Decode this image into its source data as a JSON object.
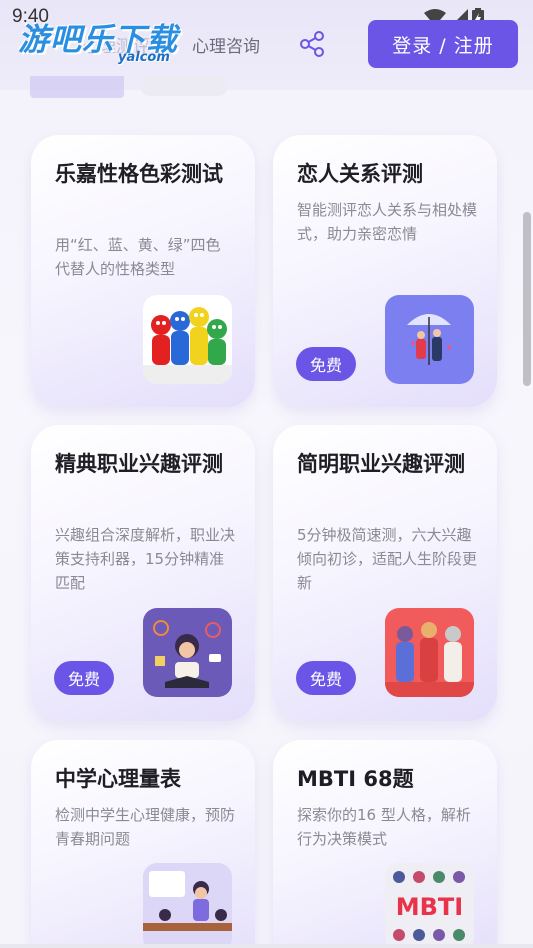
{
  "status_bar": {
    "time": "9:40"
  },
  "watermark": {
    "main": "游吧乐下载",
    "sub": "yalcom"
  },
  "header": {
    "tab_psych_test": "心理测评",
    "tab_psych_consult": "心理咨询",
    "login_label": "登录 / 注册"
  },
  "colors": {
    "accent": "#6a55e6",
    "card_end": "#e4defb"
  },
  "cards": [
    {
      "title": "乐嘉性格色彩测试",
      "desc": "用“红、蓝、黄、绿”四色代替人的性格类型",
      "badge": "",
      "icon": "four-color-people-icon"
    },
    {
      "title": "恋人关系评测",
      "desc": "智能测评恋人关系与相处模式，助力亲密恋情",
      "badge": "免费",
      "icon": "couple-umbrella-icon"
    },
    {
      "title": "精典职业兴趣评测",
      "desc": "兴趣组合深度解析，职业决策支持利器，15分钟精准匹配",
      "badge": "免费",
      "icon": "student-reading-icon"
    },
    {
      "title": "简明职业兴趣评测",
      "desc": "5分钟极简速测，六大兴趣倾向初诊，适配人生阶段更新",
      "badge": "免费",
      "icon": "workers-group-icon"
    },
    {
      "title": "中学心理量表",
      "desc": "检测中学生心理健康，预防青春期问题",
      "badge": "",
      "icon": "classroom-icon"
    },
    {
      "title": "MBTI 68题",
      "desc": "探索你的16 型人格，解析行为决策模式",
      "badge": "",
      "icon": "mbti-icon",
      "icon_text": "MBTI"
    }
  ]
}
